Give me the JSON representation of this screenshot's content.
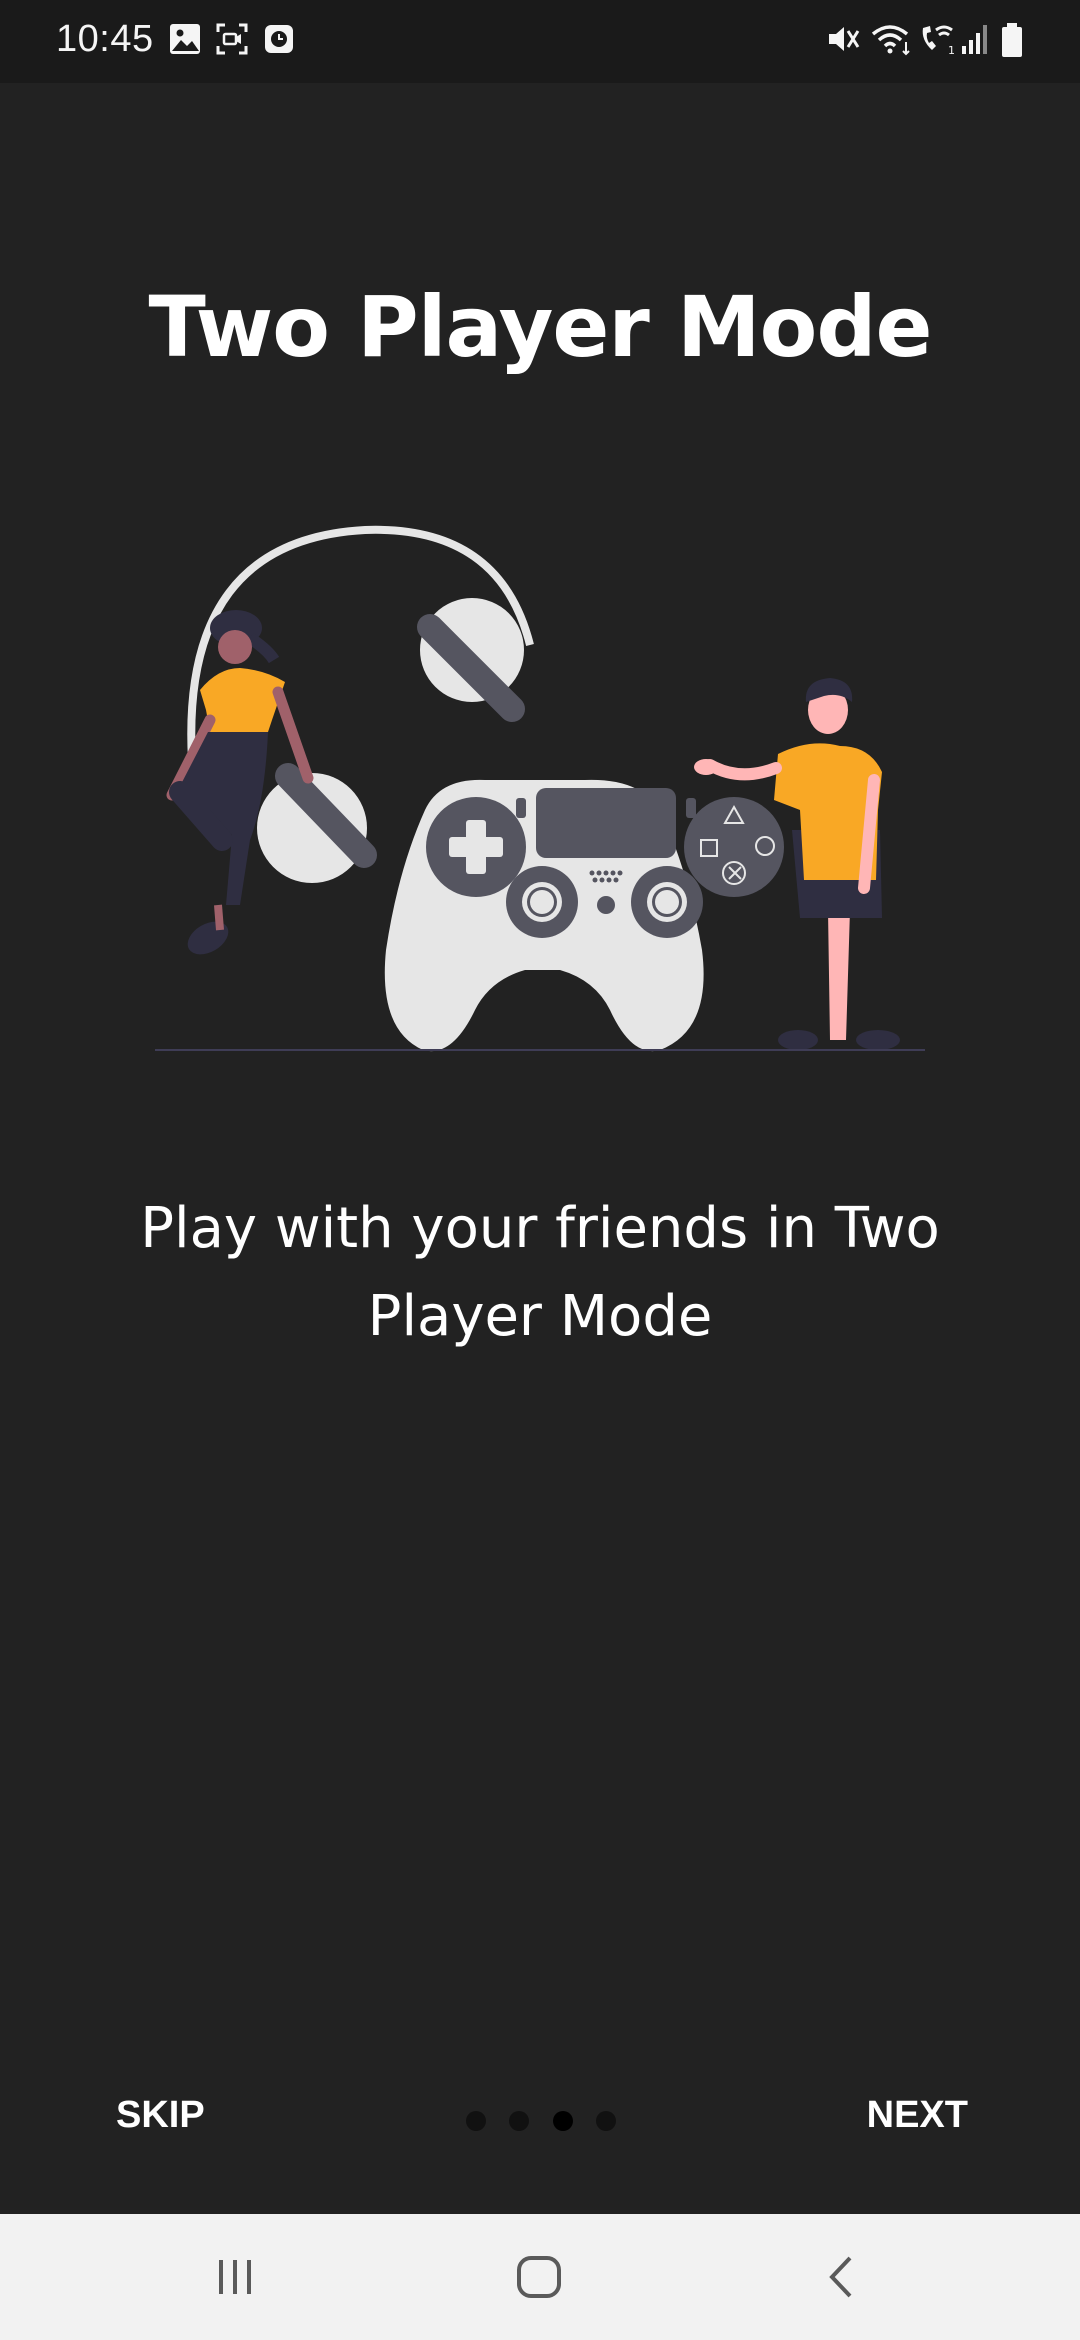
{
  "status_bar": {
    "time": "10:45",
    "left_icons": [
      "gallery-icon",
      "screen-recorder-icon",
      "clock-app-icon"
    ],
    "right_icons": [
      "mute-icon",
      "wifi-icon",
      "wifi-calling-icon",
      "signal-icon",
      "battery-icon"
    ]
  },
  "onboarding": {
    "title": "Two Player Mode",
    "description": "Play with your friends in Two Player Mode",
    "illustration": "two-players-with-game-controller",
    "skip_label": "SKIP",
    "next_label": "NEXT",
    "page_count": 4,
    "current_page": 3
  },
  "colors": {
    "background": "#222222",
    "accent_shirt": "#F9A825",
    "controller": "#E6E6E6",
    "controller_dark": "#555560"
  },
  "nav_bar": {
    "icons": [
      "recent-apps-icon",
      "home-icon",
      "back-icon"
    ]
  }
}
